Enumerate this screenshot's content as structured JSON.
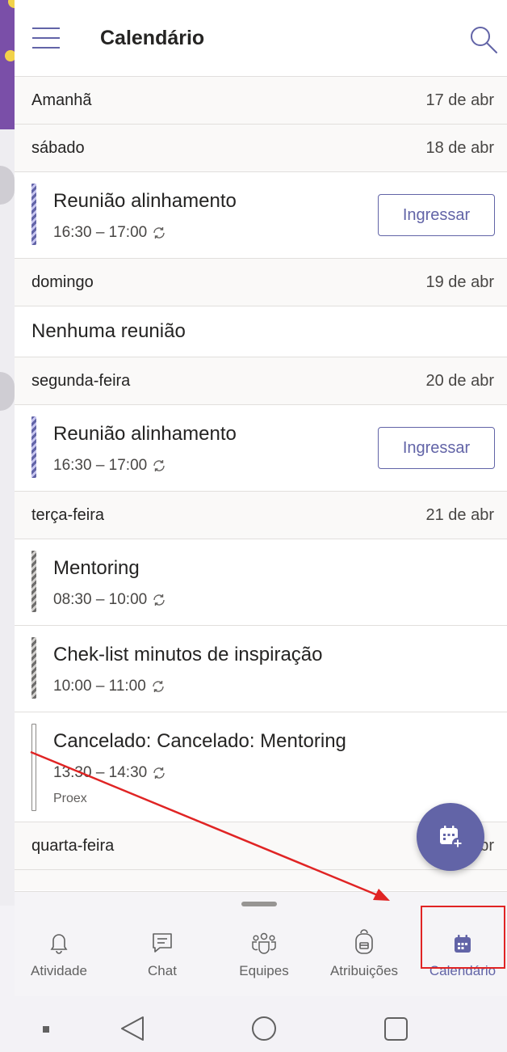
{
  "app": {
    "title": "Calendário"
  },
  "colors": {
    "accent": "#6264a7",
    "annotation": "#e02424"
  },
  "days": [
    {
      "day": "Amanhã",
      "date": "17 de abr",
      "meetings": []
    },
    {
      "day": "sábado",
      "date": "18 de abr",
      "meetings": [
        {
          "title": "Reunião alinhamento",
          "time": "16:30 – 17:00",
          "join": "Ingressar",
          "recurring": true
        }
      ]
    },
    {
      "day": "domingo",
      "date": "19 de abr",
      "empty": "Nenhuma reunião"
    },
    {
      "day": "segunda-feira",
      "date": "20 de abr",
      "meetings": [
        {
          "title": "Reunião alinhamento",
          "time": "16:30 – 17:00",
          "join": "Ingressar",
          "recurring": true
        }
      ]
    },
    {
      "day": "terça-feira",
      "date": "21 de abr",
      "meetings": [
        {
          "title": "Mentoring",
          "time": "08:30 – 10:00",
          "recurring": true
        },
        {
          "title": "Chek-list minutos de inspiração",
          "time": "10:00 – 11:00",
          "recurring": true
        },
        {
          "title": "Cancelado: Cancelado: Mentoring",
          "time": "13:30 – 14:30",
          "organizer": "Proex",
          "recurring": true
        }
      ]
    },
    {
      "day": "quarta-feira",
      "date": "22 de abr"
    }
  ],
  "fab": {
    "icon": "new-meeting-icon"
  },
  "nav": {
    "items": [
      {
        "label": "Atividade",
        "icon": "bell-icon"
      },
      {
        "label": "Chat",
        "icon": "chat-icon"
      },
      {
        "label": "Equipes",
        "icon": "teams-icon"
      },
      {
        "label": "Atribuições",
        "icon": "backpack-icon"
      },
      {
        "label": "Calendário",
        "icon": "calendar-icon",
        "active": true
      }
    ]
  },
  "system_nav": {
    "icons": [
      "menu-dot-icon",
      "back-icon",
      "home-icon",
      "recents-icon"
    ]
  }
}
